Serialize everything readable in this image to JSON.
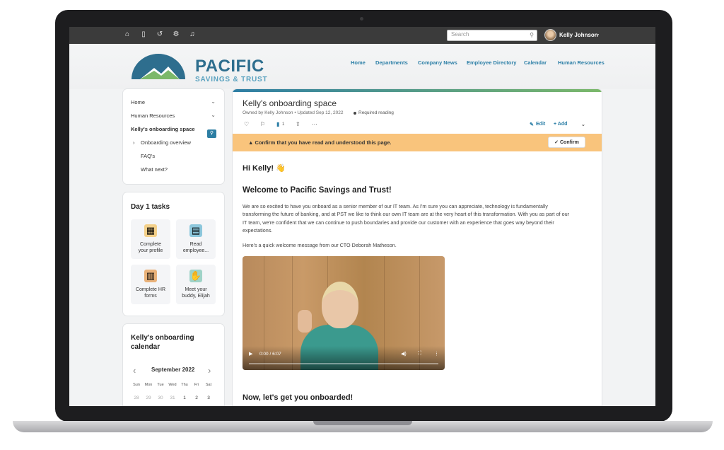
{
  "topbar": {
    "icons": [
      "home-icon",
      "bookmark-icon",
      "history-icon",
      "org-icon",
      "bell-icon"
    ],
    "search_placeholder": "Search",
    "user_name": "Kelly Johnson"
  },
  "brand": {
    "title": "PACIFIC",
    "subtitle": "SAVINGS & TRUST",
    "primary_color": "#2e6e8e",
    "accent_color": "#58a1bf"
  },
  "nav": {
    "items": [
      "Home",
      "Departments",
      "Company News",
      "Employee Directory",
      "Calendar",
      "Human Resources"
    ]
  },
  "sidebar": {
    "home": "Home",
    "hr": "Human Resources",
    "space": "Kelly's onboarding space",
    "overview": "Onboarding overview",
    "faqs": "FAQ's",
    "whatnext": "What next?"
  },
  "tasks": {
    "title": "Day 1 tasks",
    "items": [
      {
        "label1": "Complete",
        "label2": "your profile",
        "icon": "profile-card-icon"
      },
      {
        "label1": "Read",
        "label2": "employee...",
        "icon": "handbook-icon"
      },
      {
        "label1": "Complete HR",
        "label2": "forms",
        "icon": "clipboard-icon"
      },
      {
        "label1": "Meet your",
        "label2": "buddy, Elijah",
        "icon": "handshake-icon"
      }
    ]
  },
  "calendar": {
    "title1": "Kelly's onboarding",
    "title2": "calendar",
    "month": "September 2022",
    "weekdays": [
      "Sun",
      "Mon",
      "Tue",
      "Wed",
      "Thu",
      "Fri",
      "Sat"
    ],
    "days": [
      "28",
      "29",
      "30",
      "31",
      "1",
      "2",
      "3"
    ]
  },
  "page": {
    "title": "Kelly's onboarding space",
    "meta": "Owned by Kelly Johnson • Updated Sep 12, 2022",
    "required": "Required reading",
    "bookmark_count": "1",
    "edit": "Edit",
    "add": "+ Add",
    "banner": "Confirm that you have read and understood this page.",
    "confirm": "Confirm",
    "greeting": "Hi Kelly! 👋",
    "welcome": "Welcome to Pacific Savings and Trust!",
    "paragraph": "We are so excited to have you onboard as a senior member of our IT team. As I'm sure you can appreciate, technology is fundamentally transforming the future of banking, and at PST we like to think our own IT team are at the very heart of this transformation. With you as part of our IT team, we're confident that we can continue to push boundaries and provide our customer with an experience that goes way beyond their expectations.",
    "video_intro": "Here's a quick welcome message from our CTO Deborah Matheson.",
    "video_time": "0:00 / 6:07",
    "next_heading": "Now, let's get you onboarded!",
    "banner_color": "#f9c47c"
  }
}
